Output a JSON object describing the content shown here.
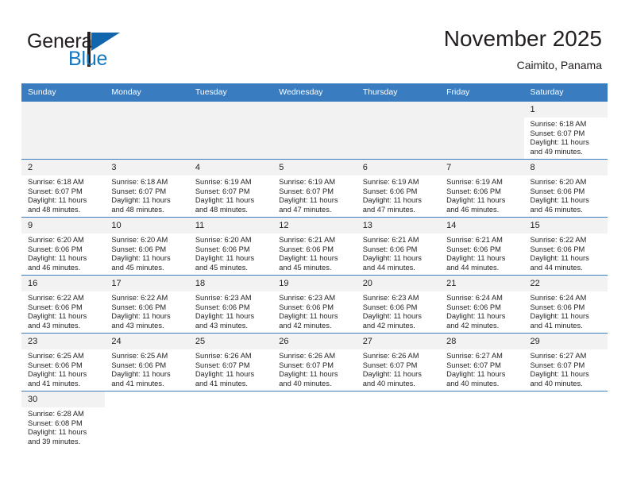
{
  "brand": {
    "line1": "General",
    "line2": "Blue",
    "accent_color": "#1077c3",
    "flag_color": "#1266ad"
  },
  "header": {
    "title": "November 2025",
    "subtitle": "Caimito, Panama",
    "header_bg_color": "#3a7cc0",
    "daynum_bg_color": "#f2f2f2"
  },
  "weekdays": [
    "Sunday",
    "Monday",
    "Tuesday",
    "Wednesday",
    "Thursday",
    "Friday",
    "Saturday"
  ],
  "labels": {
    "sunrise_prefix": "Sunrise: ",
    "sunset_prefix": "Sunset: ",
    "daylight_prefix": "Daylight: "
  },
  "weeks": [
    [
      {
        "blank": true
      },
      {
        "blank": true
      },
      {
        "blank": true
      },
      {
        "blank": true
      },
      {
        "blank": true
      },
      {
        "blank": true
      },
      {
        "day": "1",
        "sunrise": "Sunrise: 6:18 AM",
        "sunset": "Sunset: 6:07 PM",
        "daylight_1": "Daylight: 11 hours",
        "daylight_2": "and 49 minutes."
      }
    ],
    [
      {
        "day": "2",
        "sunrise": "Sunrise: 6:18 AM",
        "sunset": "Sunset: 6:07 PM",
        "daylight_1": "Daylight: 11 hours",
        "daylight_2": "and 48 minutes."
      },
      {
        "day": "3",
        "sunrise": "Sunrise: 6:18 AM",
        "sunset": "Sunset: 6:07 PM",
        "daylight_1": "Daylight: 11 hours",
        "daylight_2": "and 48 minutes."
      },
      {
        "day": "4",
        "sunrise": "Sunrise: 6:19 AM",
        "sunset": "Sunset: 6:07 PM",
        "daylight_1": "Daylight: 11 hours",
        "daylight_2": "and 48 minutes."
      },
      {
        "day": "5",
        "sunrise": "Sunrise: 6:19 AM",
        "sunset": "Sunset: 6:07 PM",
        "daylight_1": "Daylight: 11 hours",
        "daylight_2": "and 47 minutes."
      },
      {
        "day": "6",
        "sunrise": "Sunrise: 6:19 AM",
        "sunset": "Sunset: 6:06 PM",
        "daylight_1": "Daylight: 11 hours",
        "daylight_2": "and 47 minutes."
      },
      {
        "day": "7",
        "sunrise": "Sunrise: 6:19 AM",
        "sunset": "Sunset: 6:06 PM",
        "daylight_1": "Daylight: 11 hours",
        "daylight_2": "and 46 minutes."
      },
      {
        "day": "8",
        "sunrise": "Sunrise: 6:20 AM",
        "sunset": "Sunset: 6:06 PM",
        "daylight_1": "Daylight: 11 hours",
        "daylight_2": "and 46 minutes."
      }
    ],
    [
      {
        "day": "9",
        "sunrise": "Sunrise: 6:20 AM",
        "sunset": "Sunset: 6:06 PM",
        "daylight_1": "Daylight: 11 hours",
        "daylight_2": "and 46 minutes."
      },
      {
        "day": "10",
        "sunrise": "Sunrise: 6:20 AM",
        "sunset": "Sunset: 6:06 PM",
        "daylight_1": "Daylight: 11 hours",
        "daylight_2": "and 45 minutes."
      },
      {
        "day": "11",
        "sunrise": "Sunrise: 6:20 AM",
        "sunset": "Sunset: 6:06 PM",
        "daylight_1": "Daylight: 11 hours",
        "daylight_2": "and 45 minutes."
      },
      {
        "day": "12",
        "sunrise": "Sunrise: 6:21 AM",
        "sunset": "Sunset: 6:06 PM",
        "daylight_1": "Daylight: 11 hours",
        "daylight_2": "and 45 minutes."
      },
      {
        "day": "13",
        "sunrise": "Sunrise: 6:21 AM",
        "sunset": "Sunset: 6:06 PM",
        "daylight_1": "Daylight: 11 hours",
        "daylight_2": "and 44 minutes."
      },
      {
        "day": "14",
        "sunrise": "Sunrise: 6:21 AM",
        "sunset": "Sunset: 6:06 PM",
        "daylight_1": "Daylight: 11 hours",
        "daylight_2": "and 44 minutes."
      },
      {
        "day": "15",
        "sunrise": "Sunrise: 6:22 AM",
        "sunset": "Sunset: 6:06 PM",
        "daylight_1": "Daylight: 11 hours",
        "daylight_2": "and 44 minutes."
      }
    ],
    [
      {
        "day": "16",
        "sunrise": "Sunrise: 6:22 AM",
        "sunset": "Sunset: 6:06 PM",
        "daylight_1": "Daylight: 11 hours",
        "daylight_2": "and 43 minutes."
      },
      {
        "day": "17",
        "sunrise": "Sunrise: 6:22 AM",
        "sunset": "Sunset: 6:06 PM",
        "daylight_1": "Daylight: 11 hours",
        "daylight_2": "and 43 minutes."
      },
      {
        "day": "18",
        "sunrise": "Sunrise: 6:23 AM",
        "sunset": "Sunset: 6:06 PM",
        "daylight_1": "Daylight: 11 hours",
        "daylight_2": "and 43 minutes."
      },
      {
        "day": "19",
        "sunrise": "Sunrise: 6:23 AM",
        "sunset": "Sunset: 6:06 PM",
        "daylight_1": "Daylight: 11 hours",
        "daylight_2": "and 42 minutes."
      },
      {
        "day": "20",
        "sunrise": "Sunrise: 6:23 AM",
        "sunset": "Sunset: 6:06 PM",
        "daylight_1": "Daylight: 11 hours",
        "daylight_2": "and 42 minutes."
      },
      {
        "day": "21",
        "sunrise": "Sunrise: 6:24 AM",
        "sunset": "Sunset: 6:06 PM",
        "daylight_1": "Daylight: 11 hours",
        "daylight_2": "and 42 minutes."
      },
      {
        "day": "22",
        "sunrise": "Sunrise: 6:24 AM",
        "sunset": "Sunset: 6:06 PM",
        "daylight_1": "Daylight: 11 hours",
        "daylight_2": "and 41 minutes."
      }
    ],
    [
      {
        "day": "23",
        "sunrise": "Sunrise: 6:25 AM",
        "sunset": "Sunset: 6:06 PM",
        "daylight_1": "Daylight: 11 hours",
        "daylight_2": "and 41 minutes."
      },
      {
        "day": "24",
        "sunrise": "Sunrise: 6:25 AM",
        "sunset": "Sunset: 6:06 PM",
        "daylight_1": "Daylight: 11 hours",
        "daylight_2": "and 41 minutes."
      },
      {
        "day": "25",
        "sunrise": "Sunrise: 6:26 AM",
        "sunset": "Sunset: 6:07 PM",
        "daylight_1": "Daylight: 11 hours",
        "daylight_2": "and 41 minutes."
      },
      {
        "day": "26",
        "sunrise": "Sunrise: 6:26 AM",
        "sunset": "Sunset: 6:07 PM",
        "daylight_1": "Daylight: 11 hours",
        "daylight_2": "and 40 minutes."
      },
      {
        "day": "27",
        "sunrise": "Sunrise: 6:26 AM",
        "sunset": "Sunset: 6:07 PM",
        "daylight_1": "Daylight: 11 hours",
        "daylight_2": "and 40 minutes."
      },
      {
        "day": "28",
        "sunrise": "Sunrise: 6:27 AM",
        "sunset": "Sunset: 6:07 PM",
        "daylight_1": "Daylight: 11 hours",
        "daylight_2": "and 40 minutes."
      },
      {
        "day": "29",
        "sunrise": "Sunrise: 6:27 AM",
        "sunset": "Sunset: 6:07 PM",
        "daylight_1": "Daylight: 11 hours",
        "daylight_2": "and 40 minutes."
      }
    ],
    [
      {
        "day": "30",
        "sunrise": "Sunrise: 6:28 AM",
        "sunset": "Sunset: 6:08 PM",
        "daylight_1": "Daylight: 11 hours",
        "daylight_2": "and 39 minutes."
      },
      {
        "blank": true,
        "white": true
      },
      {
        "blank": true,
        "white": true
      },
      {
        "blank": true,
        "white": true
      },
      {
        "blank": true,
        "white": true
      },
      {
        "blank": true,
        "white": true
      },
      {
        "blank": true,
        "white": true
      }
    ]
  ]
}
